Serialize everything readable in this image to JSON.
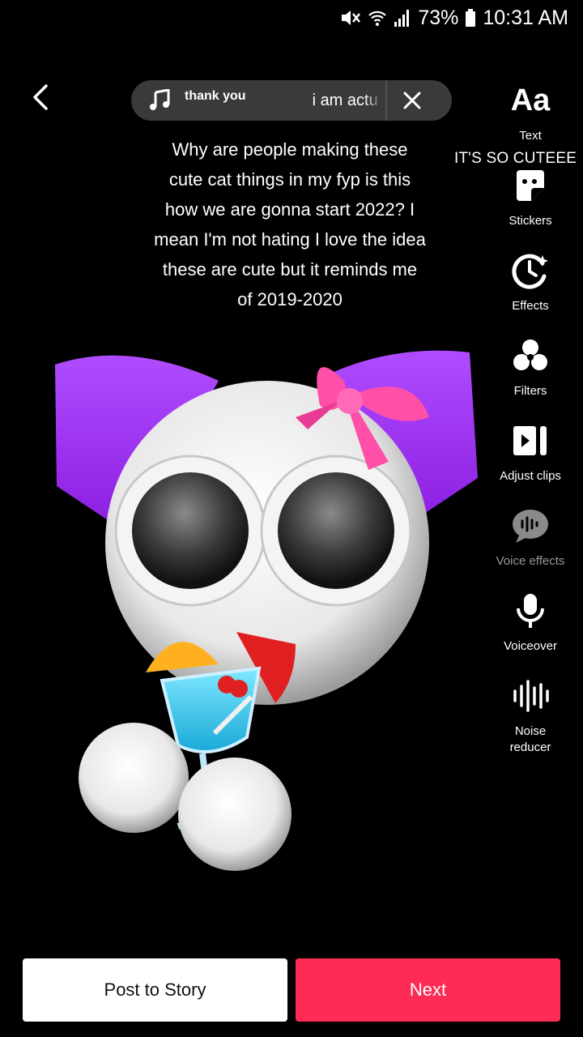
{
  "status": {
    "battery": "73%",
    "time": "10:31 AM"
  },
  "sound": {
    "title_part1": "thank you",
    "title_part2": "i am actu"
  },
  "caption": "Why are people making these cute cat things in my fyp is this how we are gonna start 2022? I mean I'm not hating I love the idea these are cute but it reminds me of 2019-2020",
  "overlay_text": "IT'S SO CUTEEE",
  "tools": [
    {
      "label": "Text",
      "icon": "text-icon"
    },
    {
      "label": "Stickers",
      "icon": "sticker-icon"
    },
    {
      "label": "Effects",
      "icon": "effects-icon"
    },
    {
      "label": "Filters",
      "icon": "filters-icon"
    },
    {
      "label": "Adjust clips",
      "icon": "adjust-clips-icon"
    },
    {
      "label": "Voice effects",
      "icon": "voice-effects-icon"
    },
    {
      "label": "Voiceover",
      "icon": "microphone-icon"
    },
    {
      "label": "Noise reducer",
      "icon": "noise-reducer-icon"
    }
  ],
  "text_tool_glyph": "Aa",
  "buttons": {
    "post_to_story": "Post to Story",
    "next": "Next"
  },
  "colors": {
    "next_button": "#fe2c55",
    "background": "#000000"
  }
}
